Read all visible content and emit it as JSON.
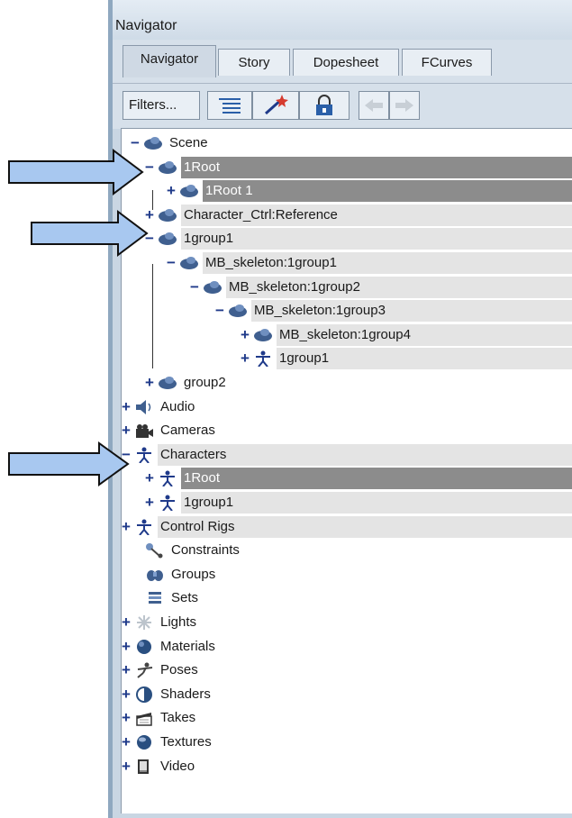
{
  "window": {
    "title": "Navigator"
  },
  "tabs": [
    {
      "label": "Navigator",
      "active": true
    },
    {
      "label": "Story",
      "active": false
    },
    {
      "label": "Dopesheet",
      "active": false
    },
    {
      "label": "FCurves",
      "active": false
    }
  ],
  "toolbar": {
    "filters_label": "Filters...",
    "buttons": [
      "list-icon",
      "wand-icon",
      "lock-icon",
      "back-arrow-icon",
      "forward-arrow-icon"
    ]
  },
  "tree": [
    {
      "label": "Scene",
      "expander": "−",
      "icon": "model-icon",
      "highlight": "none"
    },
    {
      "label": "1Root",
      "expander": "−",
      "icon": "model-icon",
      "highlight": "selected"
    },
    {
      "label": "1Root 1",
      "expander": "+",
      "icon": "model-icon",
      "highlight": "selected"
    },
    {
      "label": "Character_Ctrl:Reference",
      "expander": "+",
      "icon": "model-icon",
      "highlight": "row"
    },
    {
      "label": "1group1",
      "expander": "−",
      "icon": "model-icon",
      "highlight": "row"
    },
    {
      "label": "MB_skeleton:1group1",
      "expander": "−",
      "icon": "model-icon",
      "highlight": "row"
    },
    {
      "label": "MB_skeleton:1group2",
      "expander": "−",
      "icon": "model-icon",
      "highlight": "row"
    },
    {
      "label": "MB_skeleton:1group3",
      "expander": "−",
      "icon": "model-icon",
      "highlight": "row"
    },
    {
      "label": "MB_skeleton:1group4",
      "expander": "+",
      "icon": "model-icon",
      "highlight": "row"
    },
    {
      "label": "1group1",
      "expander": "+",
      "icon": "character-icon",
      "highlight": "row"
    },
    {
      "label": "group2",
      "expander": "+",
      "icon": "model-icon",
      "highlight": "none"
    },
    {
      "label": "Audio",
      "expander": "+",
      "icon": "audio-icon",
      "highlight": "none"
    },
    {
      "label": "Cameras",
      "expander": "+",
      "icon": "camera-icon",
      "highlight": "none"
    },
    {
      "label": "Characters",
      "expander": "−",
      "icon": "character-icon",
      "highlight": "row"
    },
    {
      "label": "1Root",
      "expander": "+",
      "icon": "character-icon",
      "highlight": "selected"
    },
    {
      "label": "1group1",
      "expander": "+",
      "icon": "character-icon",
      "highlight": "row"
    },
    {
      "label": "Control Rigs",
      "expander": "+",
      "icon": "character-icon",
      "highlight": "row"
    },
    {
      "label": "Constraints",
      "expander": "",
      "icon": "constraint-icon",
      "highlight": "none"
    },
    {
      "label": "Groups",
      "expander": "",
      "icon": "groups-icon",
      "highlight": "none"
    },
    {
      "label": "Sets",
      "expander": "",
      "icon": "sets-icon",
      "highlight": "none"
    },
    {
      "label": "Lights",
      "expander": "+",
      "icon": "light-icon",
      "highlight": "none"
    },
    {
      "label": "Materials",
      "expander": "+",
      "icon": "material-icon",
      "highlight": "none"
    },
    {
      "label": "Poses",
      "expander": "+",
      "icon": "pose-icon",
      "highlight": "none"
    },
    {
      "label": "Shaders",
      "expander": "+",
      "icon": "shader-icon",
      "highlight": "none"
    },
    {
      "label": "Takes",
      "expander": "+",
      "icon": "clapper-icon",
      "highlight": "none"
    },
    {
      "label": "Textures",
      "expander": "+",
      "icon": "texture-icon",
      "highlight": "none"
    },
    {
      "label": "Video",
      "expander": "+",
      "icon": "video-icon",
      "highlight": "none"
    }
  ],
  "colors": {
    "arrow_fill": "#a8c8f0",
    "selected_row": "#8c8c8c",
    "row_band": "#e4e4e4",
    "expander": "#1f3a8a"
  }
}
